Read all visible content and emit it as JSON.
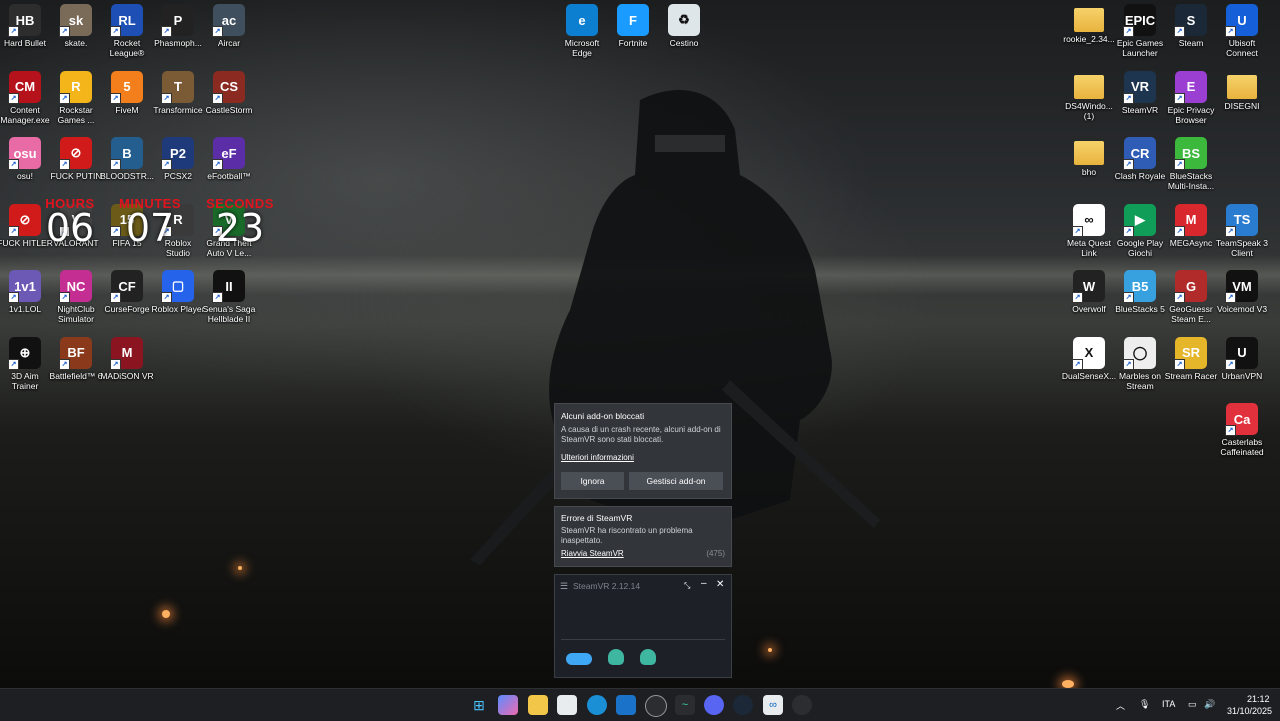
{
  "desktop": {
    "left_icons": [
      {
        "label": "Hard Bullet",
        "color": "#2d2d2d",
        "glyph": "HB"
      },
      {
        "label": "skate.",
        "color": "#7a6a58",
        "glyph": "sk"
      },
      {
        "label": "Rocket\nLeague®",
        "color": "#1d4fb5",
        "glyph": "RL"
      },
      {
        "label": "Phasmoph...",
        "color": "#222",
        "glyph": "P"
      },
      {
        "label": "Aircar",
        "color": "#3f4f5e",
        "glyph": "ac"
      },
      {
        "label": "Content\nManager.exe",
        "color": "#b5121b",
        "glyph": "CM"
      },
      {
        "label": "Rockstar\nGames ...",
        "color": "#f3b51a",
        "glyph": "R"
      },
      {
        "label": "FiveM",
        "color": "#f27f1b",
        "glyph": "5"
      },
      {
        "label": "Transformice",
        "color": "#7b5a36",
        "glyph": "T"
      },
      {
        "label": "CastleStorm",
        "color": "#8a2a20",
        "glyph": "CS"
      },
      {
        "label": "osu!",
        "color": "#e86ba6",
        "glyph": "osu"
      },
      {
        "label": "FUCK PUTIN",
        "color": "#d11a1a",
        "glyph": "⊘"
      },
      {
        "label": "BLOODSTR...",
        "color": "#235e8f",
        "glyph": "B"
      },
      {
        "label": "PCSX2",
        "color": "#1f3a7a",
        "glyph": "P2"
      },
      {
        "label": "eFootball™",
        "color": "#5b2ea8",
        "glyph": "eF"
      },
      {
        "label": "FUCK HITLER",
        "color": "#d11a1a",
        "glyph": "⊘"
      },
      {
        "label": "VALORANT",
        "color": "#444",
        "glyph": "V"
      },
      {
        "label": "FIFA 15",
        "color": "#6b5a18",
        "glyph": "15"
      },
      {
        "label": "Roblox\nStudio",
        "color": "#3a3a3a",
        "glyph": "R"
      },
      {
        "label": "Grand Theft\nAuto V Le...",
        "color": "#1a6b2a",
        "glyph": "V"
      },
      {
        "label": "1v1.LOL",
        "color": "#6c58b5",
        "glyph": "1v1"
      },
      {
        "label": "NightClub\nSimulator",
        "color": "#c42d92",
        "glyph": "NC"
      },
      {
        "label": "CurseForge",
        "color": "#222",
        "glyph": "CF"
      },
      {
        "label": "Roblox Player",
        "color": "#2563eb",
        "glyph": "▢"
      },
      {
        "label": "Senua's Saga\nHellblade II",
        "color": "#111",
        "glyph": "II"
      },
      {
        "label": "3D Aim\nTrainer",
        "color": "#111",
        "glyph": "⊕"
      },
      {
        "label": "Battlefield™ 6",
        "color": "#8a3a1a",
        "glyph": "BF"
      },
      {
        "label": "MADiSON VR",
        "color": "#8a1520",
        "glyph": "M"
      }
    ],
    "center_icons": [
      {
        "label": "Microsoft\nEdge",
        "color": "#0c7fd0",
        "glyph": "e"
      },
      {
        "label": "Fortnite",
        "color": "#1a9bff",
        "glyph": "F"
      },
      {
        "label": "Cestino",
        "color": "#dfe6ea",
        "glyph": "♻"
      }
    ],
    "right_icons": [
      {
        "label": "rookie_2.34...",
        "color": "#f1c85a",
        "glyph": "",
        "folder": true
      },
      {
        "label": "Epic Games\nLauncher",
        "color": "#111",
        "glyph": "EPIC"
      },
      {
        "label": "Steam",
        "color": "#1b2838",
        "glyph": "S"
      },
      {
        "label": "Ubisoft\nConnect",
        "color": "#1560d8",
        "glyph": "U"
      },
      {
        "label": "DS4Windo...\n(1)",
        "color": "#f1c85a",
        "glyph": "",
        "folder": true
      },
      {
        "label": "SteamVR",
        "color": "#1e3550",
        "glyph": "VR"
      },
      {
        "label": "Epic Privacy\nBrowser",
        "color": "#9b3fd3",
        "glyph": "E"
      },
      {
        "label": "DISEGNI",
        "color": "#f1c85a",
        "glyph": "",
        "folder": true
      },
      {
        "label": "bho",
        "color": "#f1c85a",
        "glyph": "",
        "folder": true
      },
      {
        "label": "Clash Royale",
        "color": "#2f5db6",
        "glyph": "CR"
      },
      {
        "label": "BlueStacks\nMulti-Insta...",
        "color": "#3cb83c",
        "glyph": "BS"
      },
      {
        "label": "",
        "color": "transparent",
        "glyph": ""
      },
      {
        "label": "Meta Quest\nLink",
        "color": "#fff",
        "glyph": "∞"
      },
      {
        "label": "Google Play\nGiochi",
        "color": "#0f9d58",
        "glyph": "▶"
      },
      {
        "label": "MEGAsync",
        "color": "#d9272e",
        "glyph": "M"
      },
      {
        "label": "TeamSpeak 3\nClient",
        "color": "#2a7cd0",
        "glyph": "TS"
      },
      {
        "label": "Overwolf",
        "color": "#222",
        "glyph": "W"
      },
      {
        "label": "BlueStacks 5",
        "color": "#37a1e0",
        "glyph": "B5"
      },
      {
        "label": "GeoGuessr\nSteam E...",
        "color": "#b22b2b",
        "glyph": "G"
      },
      {
        "label": "Voicemod V3",
        "color": "#111",
        "glyph": "VM"
      },
      {
        "label": "DualSenseX...",
        "color": "#fff",
        "glyph": "X"
      },
      {
        "label": "Marbles on\nStream",
        "color": "#eee",
        "glyph": "◯"
      },
      {
        "label": "Stream Racer",
        "color": "#e5b52a",
        "glyph": "SR"
      },
      {
        "label": "UrbanVPN",
        "color": "#111",
        "glyph": "U"
      },
      {
        "label": "",
        "color": "transparent",
        "glyph": ""
      },
      {
        "label": "",
        "color": "transparent",
        "glyph": ""
      },
      {
        "label": "",
        "color": "transparent",
        "glyph": ""
      },
      {
        "label": "Casterlabs\nCaffeinated",
        "color": "#e0313c",
        "glyph": "Ca"
      }
    ]
  },
  "clock_widget": {
    "hours_label": "HOURS",
    "hours": "06",
    "minutes_label": "MINUTES",
    "minutes": "07",
    "seconds_label": "SECONDS",
    "seconds": "23"
  },
  "notifications": {
    "addons": {
      "title": "Alcuni add-on bloccati",
      "body": "A causa di un crash recente, alcuni add-on di SteamVR sono stati bloccati.",
      "link": "Ulteriori informazioni",
      "ignore_btn": "Ignora",
      "manage_btn": "Gestisci add-on"
    },
    "error": {
      "title": "Errore di SteamVR",
      "body": "SteamVR ha riscontrato un problema inaspettato.",
      "link": "Riavvia SteamVR",
      "code": "(475)"
    },
    "steamvr_window": {
      "title": "SteamVR 2.12.14"
    }
  },
  "taskbar": {
    "language": "ITA",
    "time": "21:12",
    "date": "31/10/2025"
  }
}
